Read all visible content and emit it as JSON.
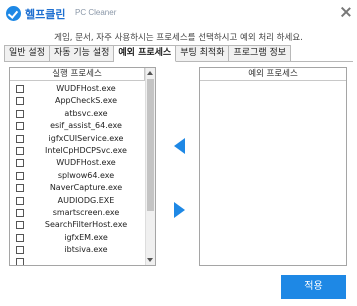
{
  "window": {
    "title": "헬프클린",
    "subtitle": "PC Cleaner",
    "description": "게임, 문서, 자주 사용하시는 프로세스를 선택하시고 예외 처리 하세요."
  },
  "tabs": [
    {
      "label": "일반 설정",
      "active": false
    },
    {
      "label": "자동 기능 설정",
      "active": false
    },
    {
      "label": "예외 프로세스",
      "active": true
    },
    {
      "label": "부팅 최적화",
      "active": false
    },
    {
      "label": "프로그램 정보",
      "active": false
    }
  ],
  "left_list": {
    "header": "실행 프로세스",
    "items": [
      "WUDFHost.exe",
      "AppCheckS.exe",
      "atbsvc.exe",
      "esif_assist_64.exe",
      "igfxCUIService.exe",
      "IntelCpHDCPSvc.exe",
      "WUDFHost.exe",
      "splwow64.exe",
      "NaverCapture.exe",
      "AUDIODG.EXE",
      "smartscreen.exe",
      "SearchFilterHost.exe",
      "igfxEM.exe",
      "ibtsiva.exe"
    ]
  },
  "right_list": {
    "header": "예외 프로세스",
    "items": []
  },
  "buttons": {
    "apply": "적용"
  },
  "colors": {
    "accent": "#1e88e5",
    "title": "#1e6fd0"
  }
}
